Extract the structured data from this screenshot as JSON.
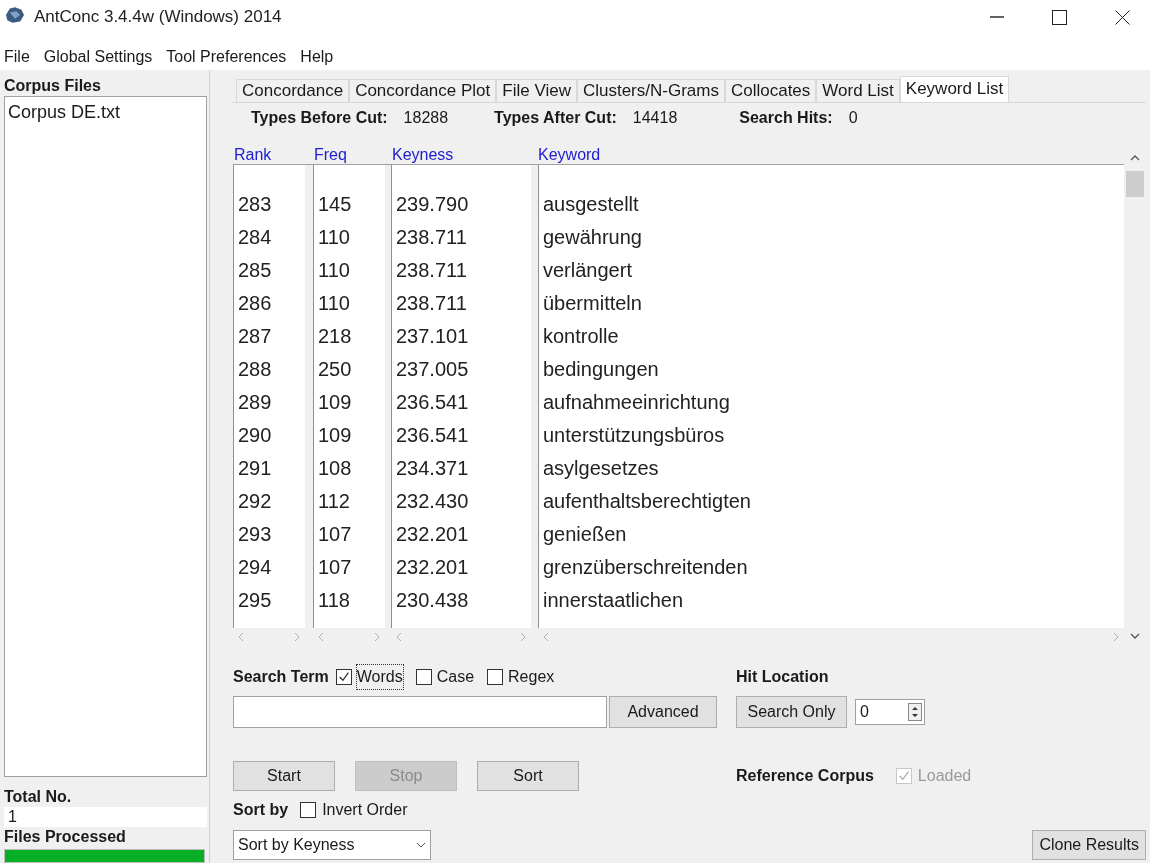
{
  "window": {
    "title": "AntConc 3.4.4w (Windows) 2014"
  },
  "menu": [
    "File",
    "Global Settings",
    "Tool Preferences",
    "Help"
  ],
  "corpus_files": {
    "label": "Corpus Files",
    "items": [
      {
        "name": "Corpus DE.txt",
        "selected": false
      }
    ]
  },
  "total": {
    "label": "Total No.",
    "value": "1"
  },
  "files_processed": {
    "label": "Files Processed",
    "level": 1
  },
  "tabs": [
    {
      "label": "Concordance",
      "selected": false
    },
    {
      "label": "Concordance Plot",
      "selected": false
    },
    {
      "label": "File View",
      "selected": false
    },
    {
      "label": "Clusters/N-Grams",
      "selected": false
    },
    {
      "label": "Collocates",
      "selected": false
    },
    {
      "label": "Word List",
      "selected": false
    },
    {
      "label": "Keyword List",
      "selected": true
    }
  ],
  "stats": [
    {
      "label": "Types Before Cut:",
      "value": "18288"
    },
    {
      "label": "Types After Cut:",
      "value": "14418"
    },
    {
      "label": "Search Hits:",
      "value": "0"
    }
  ],
  "table": {
    "columns": [
      "Rank",
      "Freq",
      "Keyness",
      "Keyword"
    ],
    "rows": [
      [
        "283",
        "145",
        "239.790",
        "ausgestellt"
      ],
      [
        "284",
        "110",
        "238.711",
        "gewährung"
      ],
      [
        "285",
        "110",
        "238.711",
        "verlängert"
      ],
      [
        "286",
        "110",
        "238.711",
        "übermitteln"
      ],
      [
        "287",
        "218",
        "237.101",
        "kontrolle"
      ],
      [
        "288",
        "250",
        "237.005",
        "bedingungen"
      ],
      [
        "289",
        "109",
        "236.541",
        "aufnahmeeinrichtung"
      ],
      [
        "290",
        "109",
        "236.541",
        "unterstützungsbüros"
      ],
      [
        "291",
        "108",
        "234.371",
        "asylgesetzes"
      ],
      [
        "292",
        "112",
        "232.430",
        "aufenthaltsberechtigten"
      ],
      [
        "293",
        "107",
        "232.201",
        "genießen"
      ],
      [
        "294",
        "107",
        "232.201",
        "grenzüberschreitenden"
      ],
      [
        "295",
        "118",
        "230.438",
        "innerstaatlichen"
      ]
    ]
  },
  "search": {
    "label": "Search Term",
    "options": [
      {
        "label": "Words",
        "checked": true
      },
      {
        "label": "Case",
        "checked": false
      },
      {
        "label": "Regex",
        "checked": false
      }
    ],
    "advanced": "Advanced"
  },
  "buttons": [
    {
      "label": "Start",
      "disabled": false
    },
    {
      "label": "Stop",
      "disabled": true
    },
    {
      "label": "Sort",
      "disabled": false
    }
  ],
  "hit_location": {
    "label": "Hit Location",
    "button": "Search Only",
    "value": "0"
  },
  "reference_corpus": {
    "label": "Reference Corpus",
    "option": "Loaded",
    "checked": true,
    "disabled": true
  },
  "sort_by": {
    "label": "Sort by",
    "invert": {
      "label": "Invert Order",
      "checked": false
    },
    "value": "Sort by Keyness"
  },
  "clone": "Clone Results"
}
